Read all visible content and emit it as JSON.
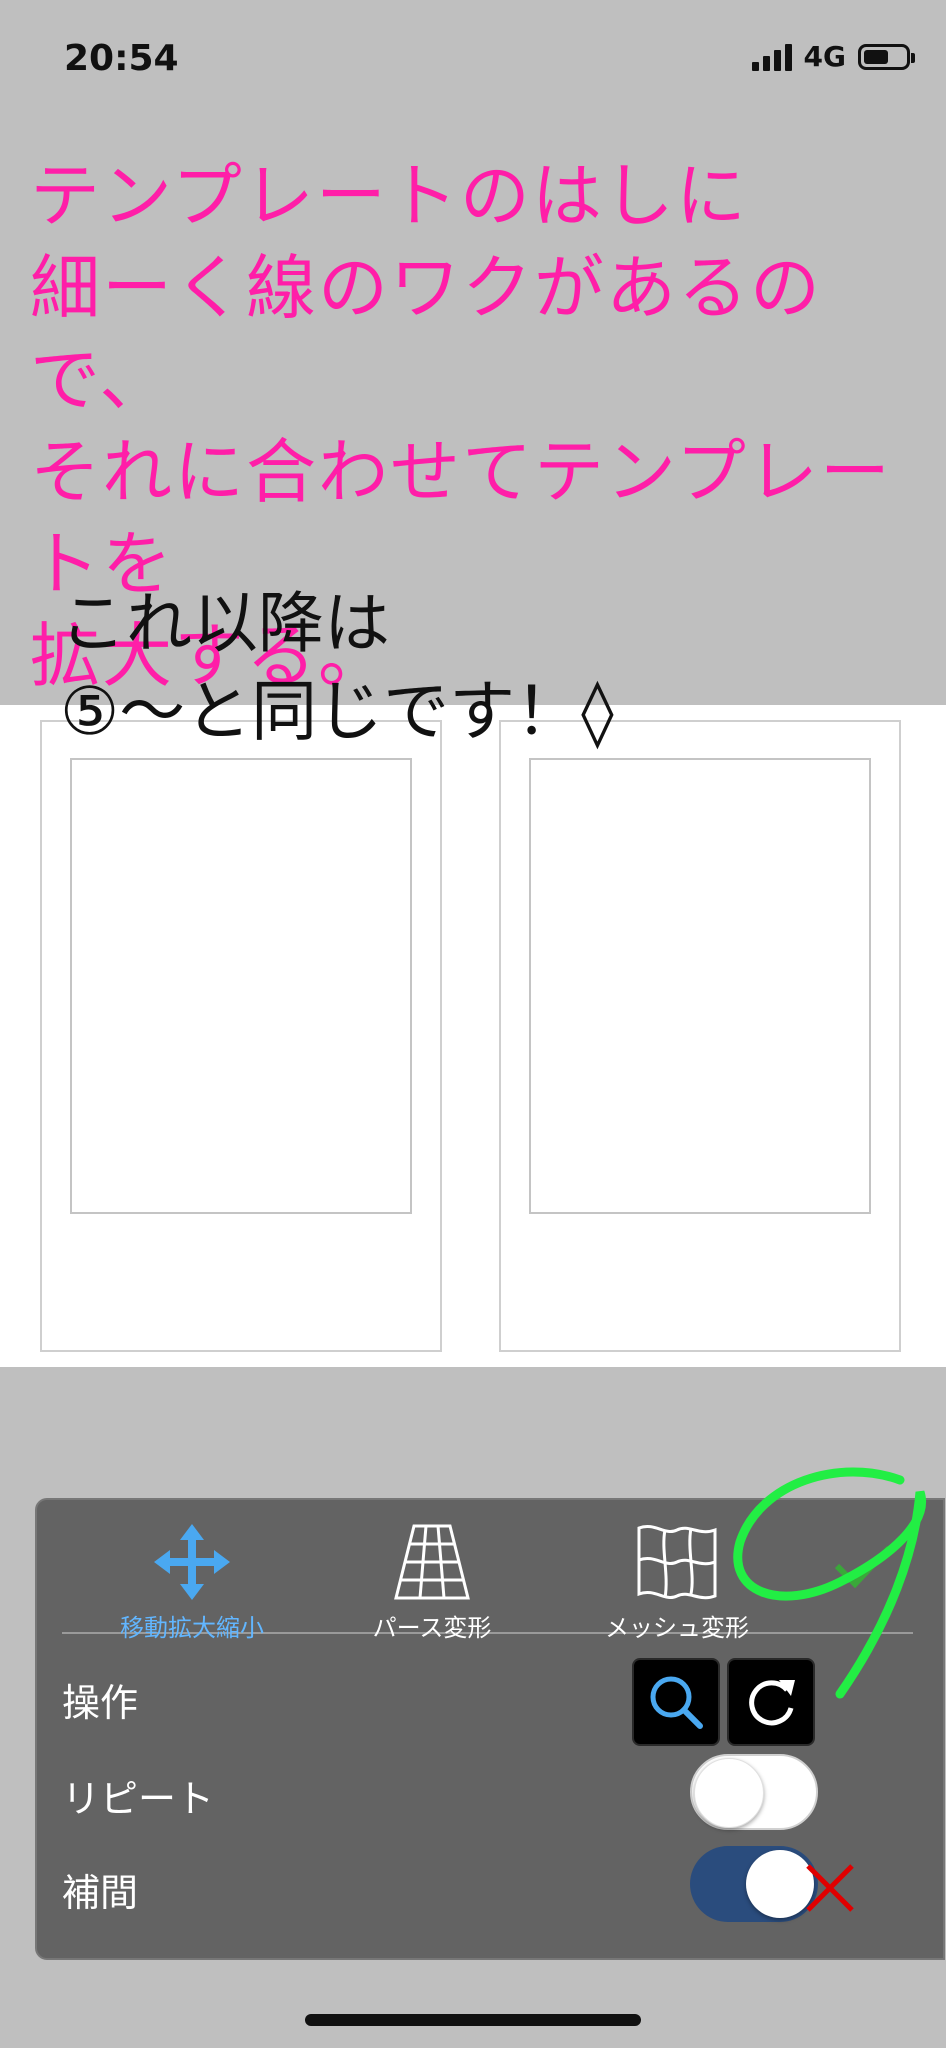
{
  "status_bar": {
    "time": "20:54",
    "network": "4G",
    "battery_level": 0.6
  },
  "annotation": {
    "pink_text": "テンプレートのはしに\n細ーく線のワクがあるので、\nそれに合わせてテンプレートを\n拡大する。",
    "black_text": "これ以降は\n⑤〜と同じです！◊",
    "pink_color": "#ff1ea8",
    "marker_number": "9",
    "marker_color": "#22ee44"
  },
  "toolbar": {
    "tabs": [
      {
        "label": "移動拡大縮小",
        "icon": "move-arrows-icon",
        "active": true
      },
      {
        "label": "パース変形",
        "icon": "perspective-grid-icon",
        "active": false
      },
      {
        "label": "メッシュ変形",
        "icon": "mesh-warp-icon",
        "active": false
      }
    ],
    "confirm_icon": "checkmark-icon",
    "cancel_icon": "close-icon",
    "active_color": "#62b6ff",
    "confirm_color": "#3aa83a",
    "cancel_color": "#e00000"
  },
  "settings": {
    "operation": {
      "label": "操作",
      "tools": [
        "zoom-icon",
        "rotate-icon"
      ]
    },
    "repeat": {
      "label": "リピート",
      "on": false
    },
    "interpolate": {
      "label": "補間",
      "on": true
    }
  }
}
